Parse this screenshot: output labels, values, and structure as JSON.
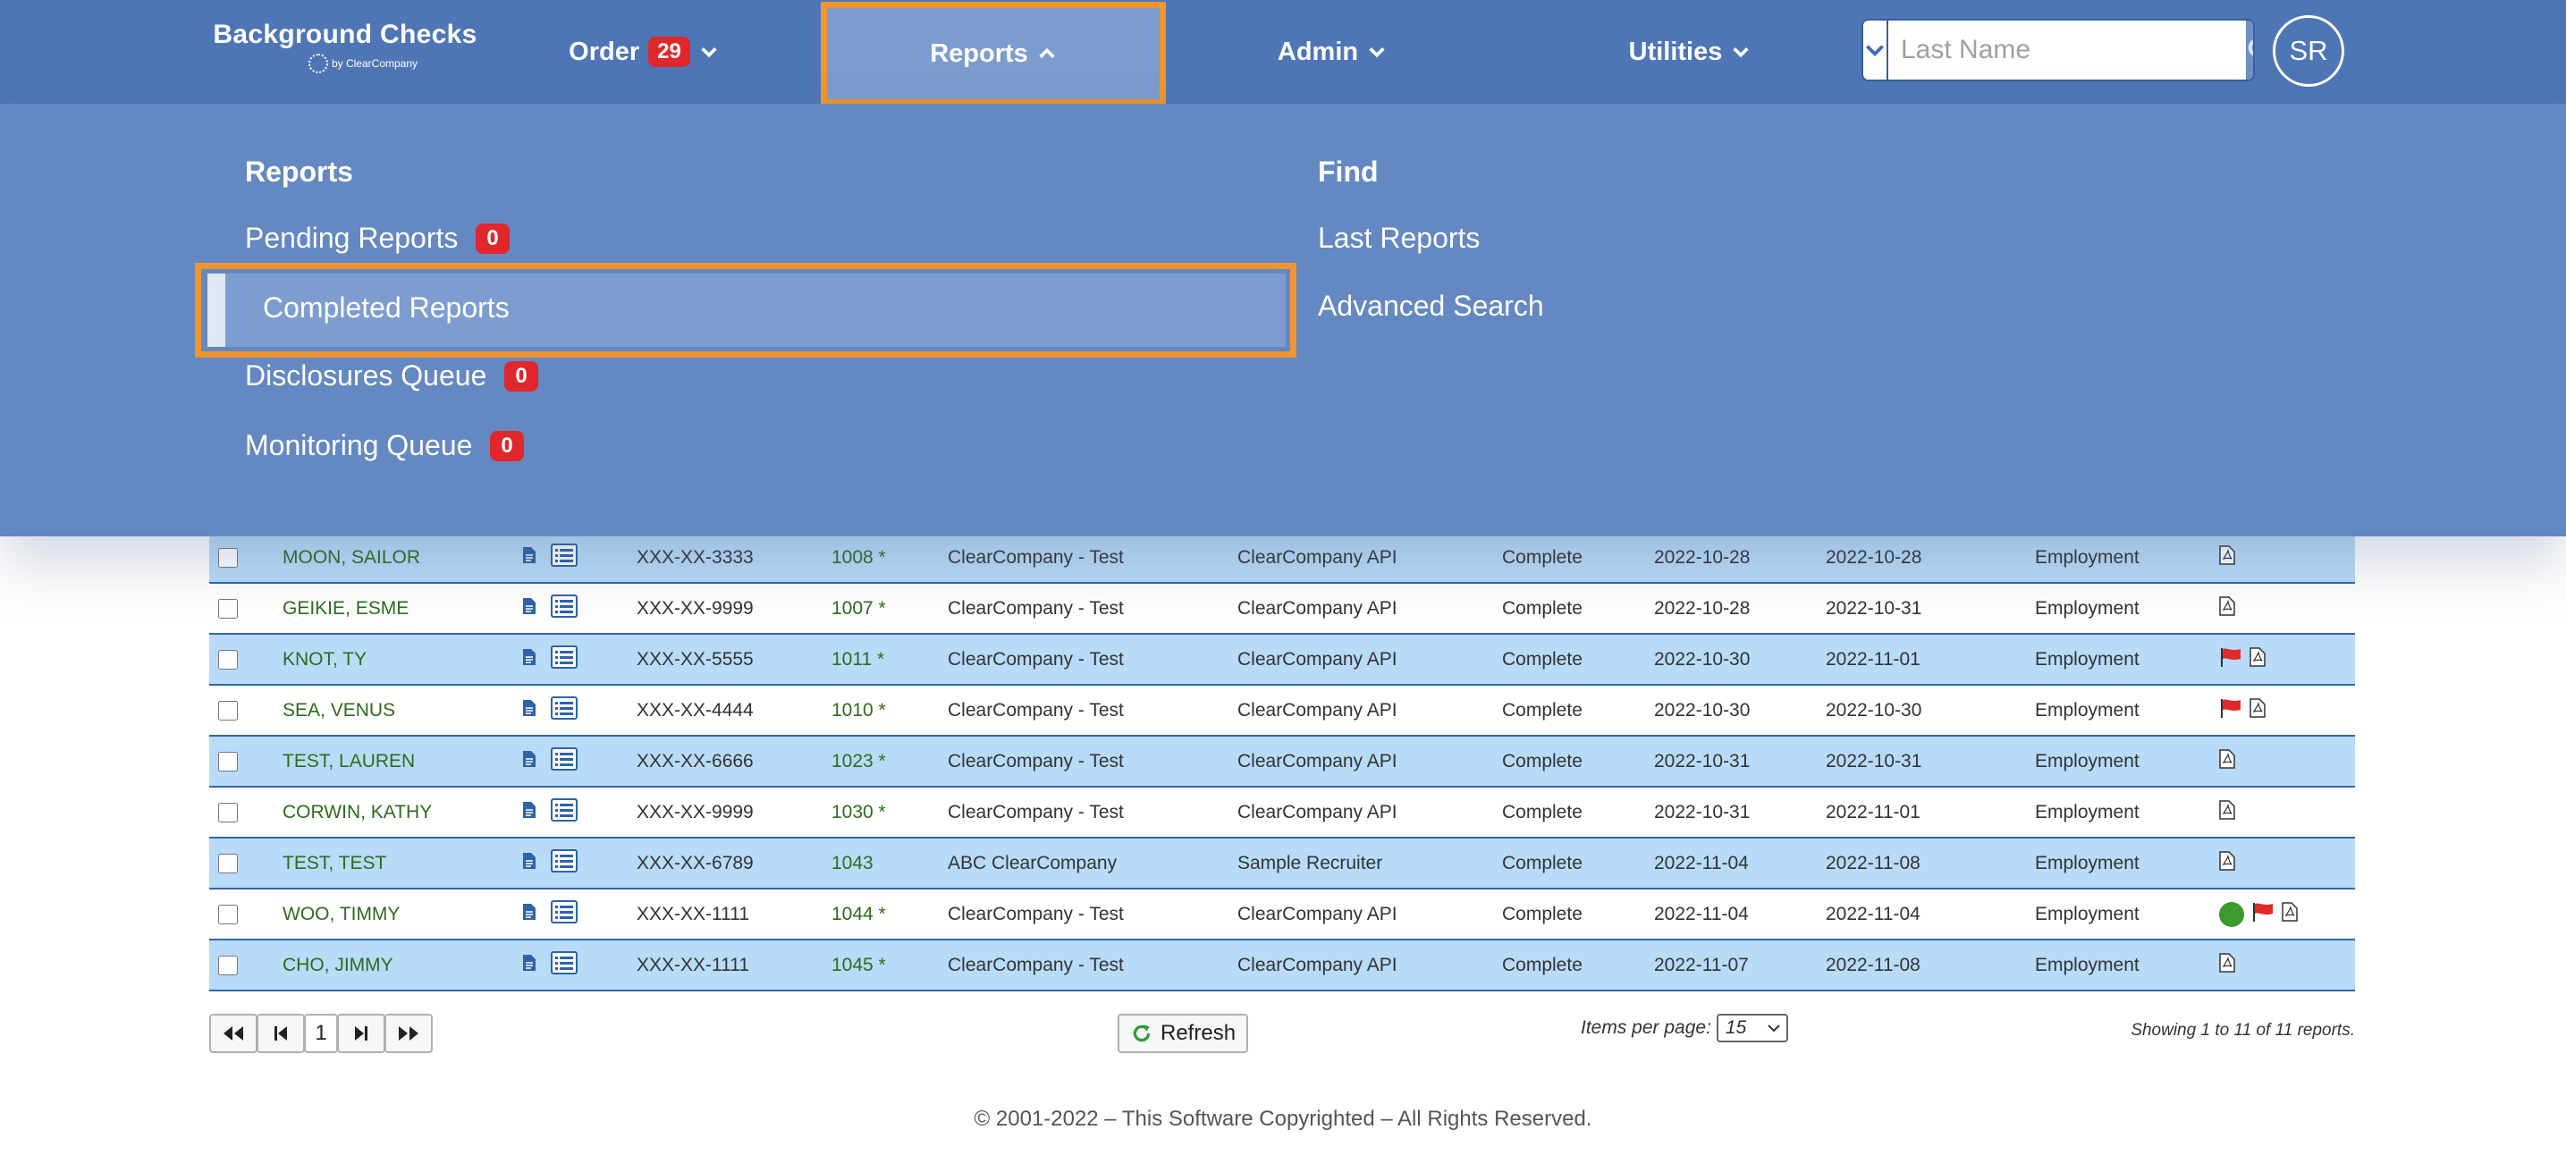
{
  "brand": {
    "title": "Background Checks",
    "sub": "by ClearCompany"
  },
  "nav": {
    "order": {
      "label": "Order",
      "badge": "29"
    },
    "reports": {
      "label": "Reports"
    },
    "admin": {
      "label": "Admin"
    },
    "utilities": {
      "label": "Utilities"
    }
  },
  "search": {
    "placeholder": "Last Name",
    "value": ""
  },
  "user": {
    "initials": "SR"
  },
  "dropdown": {
    "reports_heading": "Reports",
    "find_heading": "Find",
    "pending": {
      "label": "Pending Reports",
      "badge": "0"
    },
    "completed": {
      "label": "Completed Reports"
    },
    "disclosures": {
      "label": "Disclosures Queue",
      "badge": "0"
    },
    "monitoring": {
      "label": "Monitoring Queue",
      "badge": "0"
    },
    "last_reports": "Last Reports",
    "advanced_search": "Advanced Search"
  },
  "rows": [
    {
      "name": "MOON, SAILOR",
      "ssn": "XXX-XX-3333",
      "id": "1008 *",
      "company": "ClearCompany - Test",
      "requester": "ClearCompany API",
      "status": "Complete",
      "ordered": "2022-10-28",
      "completed": "2022-10-28",
      "type": "Employment",
      "flags": [
        "pdf"
      ]
    },
    {
      "name": "GEIKIE, ESME",
      "ssn": "XXX-XX-9999",
      "id": "1007 *",
      "company": "ClearCompany - Test",
      "requester": "ClearCompany API",
      "status": "Complete",
      "ordered": "2022-10-28",
      "completed": "2022-10-31",
      "type": "Employment",
      "flags": [
        "pdf"
      ]
    },
    {
      "name": "KNOT, TY",
      "ssn": "XXX-XX-5555",
      "id": "1011 *",
      "company": "ClearCompany - Test",
      "requester": "ClearCompany API",
      "status": "Complete",
      "ordered": "2022-10-30",
      "completed": "2022-11-01",
      "type": "Employment",
      "flags": [
        "flag",
        "pdf"
      ]
    },
    {
      "name": "SEA, VENUS",
      "ssn": "XXX-XX-4444",
      "id": "1010 *",
      "company": "ClearCompany - Test",
      "requester": "ClearCompany API",
      "status": "Complete",
      "ordered": "2022-10-30",
      "completed": "2022-10-30",
      "type": "Employment",
      "flags": [
        "flag",
        "pdf"
      ]
    },
    {
      "name": "TEST, LAUREN",
      "ssn": "XXX-XX-6666",
      "id": "1023 *",
      "company": "ClearCompany - Test",
      "requester": "ClearCompany API",
      "status": "Complete",
      "ordered": "2022-10-31",
      "completed": "2022-10-31",
      "type": "Employment",
      "flags": [
        "pdf"
      ]
    },
    {
      "name": "CORWIN, KATHY",
      "ssn": "XXX-XX-9999",
      "id": "1030 *",
      "company": "ClearCompany - Test",
      "requester": "ClearCompany API",
      "status": "Complete",
      "ordered": "2022-10-31",
      "completed": "2022-11-01",
      "type": "Employment",
      "flags": [
        "pdf"
      ]
    },
    {
      "name": "TEST, TEST",
      "ssn": "XXX-XX-6789",
      "id": "1043",
      "company": "ABC ClearCompany",
      "requester": "Sample Recruiter",
      "status": "Complete",
      "ordered": "2022-11-04",
      "completed": "2022-11-08",
      "type": "Employment",
      "flags": [
        "pdf"
      ]
    },
    {
      "name": "WOO, TIMMY",
      "ssn": "XXX-XX-1111",
      "id": "1044 *",
      "company": "ClearCompany - Test",
      "requester": "ClearCompany API",
      "status": "Complete",
      "ordered": "2022-11-04",
      "completed": "2022-11-04",
      "type": "Employment",
      "flags": [
        "dot",
        "flag",
        "pdf"
      ]
    },
    {
      "name": "CHO, JIMMY",
      "ssn": "XXX-XX-1111",
      "id": "1045 *",
      "company": "ClearCompany - Test",
      "requester": "ClearCompany API",
      "status": "Complete",
      "ordered": "2022-11-07",
      "completed": "2022-11-08",
      "type": "Employment",
      "flags": [
        "pdf"
      ]
    }
  ],
  "pagination": {
    "current_page": "1",
    "refresh_label": "Refresh",
    "items_per_page_label": "Items per page:",
    "items_per_page": "15",
    "showing": "Showing 1 to 11 of 11 reports."
  },
  "footer": "© 2001-2022 – This Software Copyrighted – All Rights Reserved.",
  "colors": {
    "nav": "#4e76b6",
    "dropdown": "#6488c2",
    "highlight": "#f0952f",
    "row_alt": "#b8dbf9",
    "badge": "#e0272c"
  }
}
